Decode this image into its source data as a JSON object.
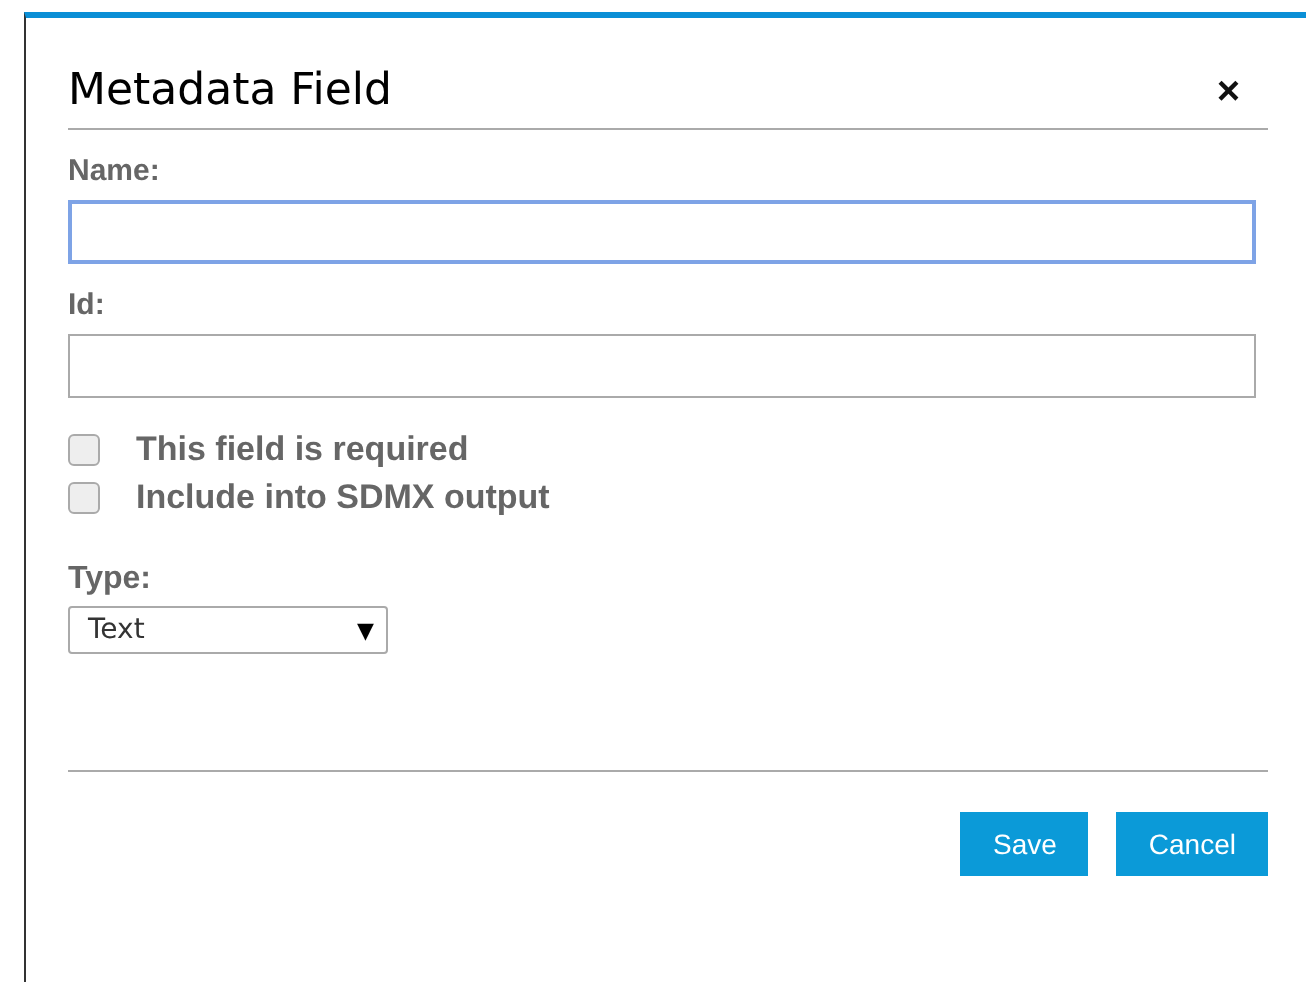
{
  "dialog": {
    "title": "Metadata Field",
    "close": "×"
  },
  "fields": [
    {
      "label": "Name:",
      "focused": true
    },
    {
      "label": "Id:",
      "focused": false
    }
  ],
  "checkboxes": [
    {
      "label": "This field is required",
      "checked": false
    },
    {
      "label": "Include into SDMX output",
      "checked": false
    }
  ],
  "type": {
    "label": "Type:",
    "value": "Text",
    "arrow": "▼"
  },
  "buttons": [
    "Save",
    "Cancel"
  ]
}
